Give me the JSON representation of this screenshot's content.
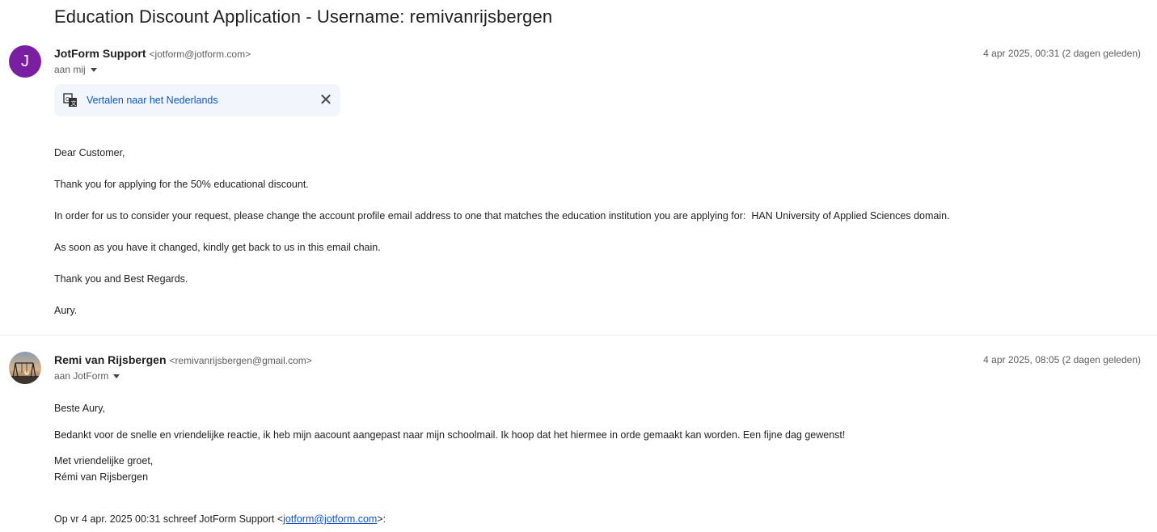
{
  "subject": "Education Discount Application - Username: remivanrijsbergen",
  "messages": [
    {
      "avatar_letter": "J",
      "avatar_color": "#7b1fa2",
      "sender_name": "JotForm Support",
      "sender_email": "<jotform@jotform.com>",
      "recipient": "aan mij",
      "date": "4 apr 2025, 00:31 (2 dagen geleden)",
      "translate_label": "Vertalen naar het Nederlands",
      "body": [
        "Dear Customer,",
        "Thank you for applying for the 50% educational discount.",
        "In order for us to consider your request, please change the account profile email address to one that matches the education institution you are applying for:  HAN University of Applied Sciences domain.",
        "As soon as you have it changed, kindly get back to us in this email chain.",
        "Thank you and Best Regards.",
        "Aury."
      ]
    },
    {
      "sender_name": "Remi van Rijsbergen",
      "sender_email": "<remivanrijsbergen@gmail.com>",
      "recipient": "aan JotForm",
      "date": "4 apr 2025, 08:05 (2 dagen geleden)",
      "body": [
        "Beste Aury,",
        "Bedankt voor de snelle en vriendelijke reactie, ik heb mijn aacount aangepast naar mijn schoolmail. Ik hoop dat het hiermee in orde gemaakt kan worden. Een fijne dag gewenst!",
        "Met vriendelijke groet,",
        "Rémi van Rijsbergen"
      ],
      "quote_prefix": "Op vr 4 apr. 2025 00:31 schreef JotForm Support <",
      "quote_link": "jotform@jotform.com",
      "quote_suffix": ">:"
    }
  ],
  "colors": {
    "link": "#0b57d0",
    "translate_bg": "#f2f6fc"
  }
}
